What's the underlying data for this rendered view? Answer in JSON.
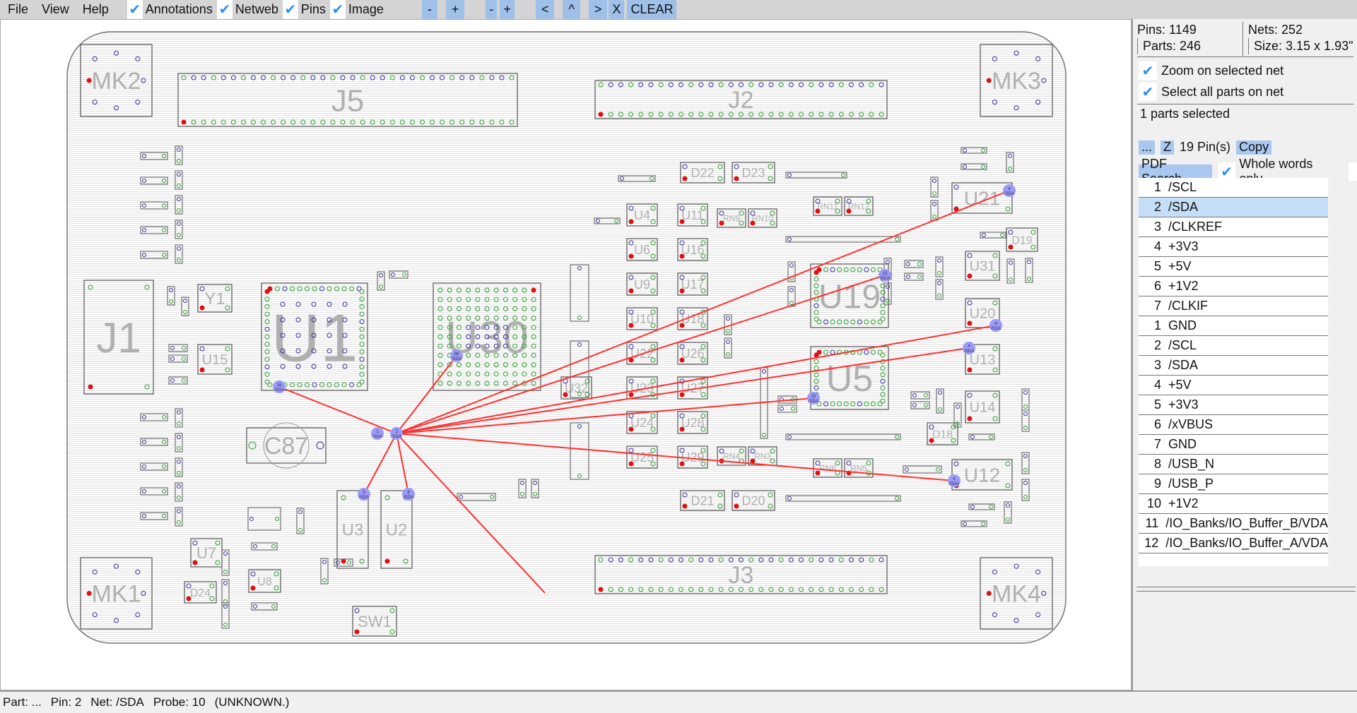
{
  "menu": [
    "File",
    "View",
    "Help"
  ],
  "toggles": [
    {
      "label": "Annotations",
      "checked": true
    },
    {
      "label": "Netweb",
      "checked": true
    },
    {
      "label": "Pins",
      "checked": true
    },
    {
      "label": "Image",
      "checked": true
    }
  ],
  "toolbar_buttons": [
    "-",
    "+",
    "-",
    "+",
    "<",
    "^",
    ">",
    "X",
    "CLEAR"
  ],
  "stats": {
    "pins": "Pins: 1149",
    "parts": "Parts: 246",
    "nets": "Nets: 252",
    "size": "Size: 3.15 x 1.93\""
  },
  "options": [
    {
      "label": "Zoom on selected net",
      "checked": true
    },
    {
      "label": "Select all parts on net",
      "checked": true
    }
  ],
  "selection": "1 parts selected",
  "actions": {
    "more": "...",
    "zoom": "Z",
    "pin_count": "19 Pin(s)",
    "copy": "Copy",
    "pdf_search": "PDF Search",
    "whole_words": "Whole words only",
    "whole_words_checked": true
  },
  "net_list": [
    {
      "n": "1",
      "net": "/SCL"
    },
    {
      "n": "2",
      "net": "/SDA",
      "selected": true
    },
    {
      "n": "3",
      "net": "/CLKREF"
    },
    {
      "n": "4",
      "net": "+3V3"
    },
    {
      "n": "5",
      "net": "+5V"
    },
    {
      "n": "6",
      "net": "+1V2"
    },
    {
      "n": "7",
      "net": "/CLKIF"
    },
    {
      "n": "1",
      "net": "GND"
    },
    {
      "n": "2",
      "net": "/SCL"
    },
    {
      "n": "3",
      "net": "/SDA"
    },
    {
      "n": "4",
      "net": "+5V"
    },
    {
      "n": "5",
      "net": "+3V3"
    },
    {
      "n": "6",
      "net": "/xVBUS"
    },
    {
      "n": "7",
      "net": "GND"
    },
    {
      "n": "8",
      "net": "/USB_N"
    },
    {
      "n": "9",
      "net": "/USB_P"
    },
    {
      "n": "10",
      "net": "+1V2"
    },
    {
      "n": "11",
      "net": "/IO_Banks/IO_Buffer_B/VDA"
    },
    {
      "n": "12",
      "net": "/IO_Banks/IO_Buffer_A/VDA"
    }
  ],
  "status": {
    "part": "Part: ...",
    "pin": "Pin: 2",
    "net": "Net: /SDA",
    "probe": "Probe: 10",
    "state": "(UNKNOWN.)"
  },
  "board": {
    "parts": [
      "MK2",
      "J5",
      "J2",
      "MK3",
      "J1",
      "Y1",
      "U15",
      "U1",
      "U30",
      "C87",
      "U3",
      "U2",
      "U7",
      "MK1",
      "SW1",
      "J3",
      "MK4",
      "U19",
      "U5",
      "U21",
      "U31",
      "U20",
      "U13",
      "U14",
      "U12",
      "D19",
      "U32",
      "U4",
      "U6",
      "U9",
      "U10",
      "U22",
      "U23",
      "U24",
      "U25",
      "U11",
      "U16",
      "U17",
      "U18",
      "U26",
      "U27",
      "U28",
      "U29",
      "D22",
      "D23",
      "D21",
      "D20",
      "RN9",
      "RN10",
      "RN4",
      "RN3",
      "RN11",
      "RN12",
      "RN6",
      "RN5",
      "D24",
      "U8",
      "D18"
    ],
    "selected_net": "/SDA",
    "net_pins": [
      {
        "num": "2",
        "net": "/SDA"
      },
      {
        "num": "1",
        "net": "/SDA"
      },
      {
        "num": "16",
        "net": "/SDA"
      },
      {
        "num": "98",
        "net": "/SDA"
      },
      {
        "num": "5",
        "net": "/SDA"
      },
      {
        "num": "6",
        "net": "/SDA"
      },
      {
        "num": "4",
        "net": "/SDA"
      },
      {
        "num": "15",
        "net": "/SDA"
      },
      {
        "num": "4",
        "net": "/SDA"
      },
      {
        "num": "4",
        "net": "/SDA"
      },
      {
        "num": "15",
        "net": "/SDA"
      },
      {
        "num": "4",
        "net": "/SDA"
      }
    ],
    "colors": {
      "net_line": "#ff3030",
      "pin_highlight": "#9a9af8",
      "pin_green": "#2aa02a",
      "pin_blue": "#3030a0",
      "pin_red": "#e01010",
      "part_label": "#b0b0b0"
    }
  }
}
